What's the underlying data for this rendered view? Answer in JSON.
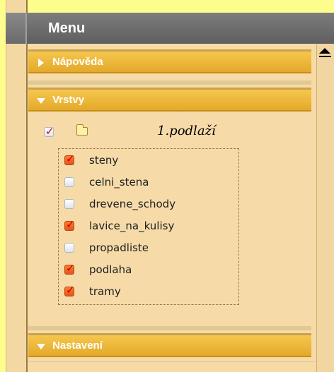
{
  "window": {
    "title": "Menu"
  },
  "sections": [
    {
      "label": "Nápověda",
      "state": "collapsed"
    },
    {
      "label": "Vrstvy",
      "state": "expanded"
    },
    {
      "label": "Nastavení",
      "state": "expanded"
    }
  ],
  "layers": {
    "group": {
      "label": "1.podlaží",
      "checked": true
    },
    "items": [
      {
        "label": "steny",
        "checked": true
      },
      {
        "label": "celni_stena",
        "checked": false
      },
      {
        "label": "drevene_schody",
        "checked": false
      },
      {
        "label": "lavice_na_kulisy",
        "checked": true
      },
      {
        "label": "propadliste",
        "checked": false
      },
      {
        "label": "podlaha",
        "checked": true
      },
      {
        "label": "tramy",
        "checked": true
      }
    ]
  },
  "icons": {
    "collapsed": "triangle-right-icon",
    "expanded": "triangle-down-icon",
    "group": "folder-icon",
    "scroll": "scroll-up-arrow-icon"
  },
  "colors": {
    "section_bar": "#e4a92a",
    "panel_bg": "#f6dba9",
    "checkbox_on": "#ff7a2a",
    "header_bg": "#6d6d6d"
  }
}
